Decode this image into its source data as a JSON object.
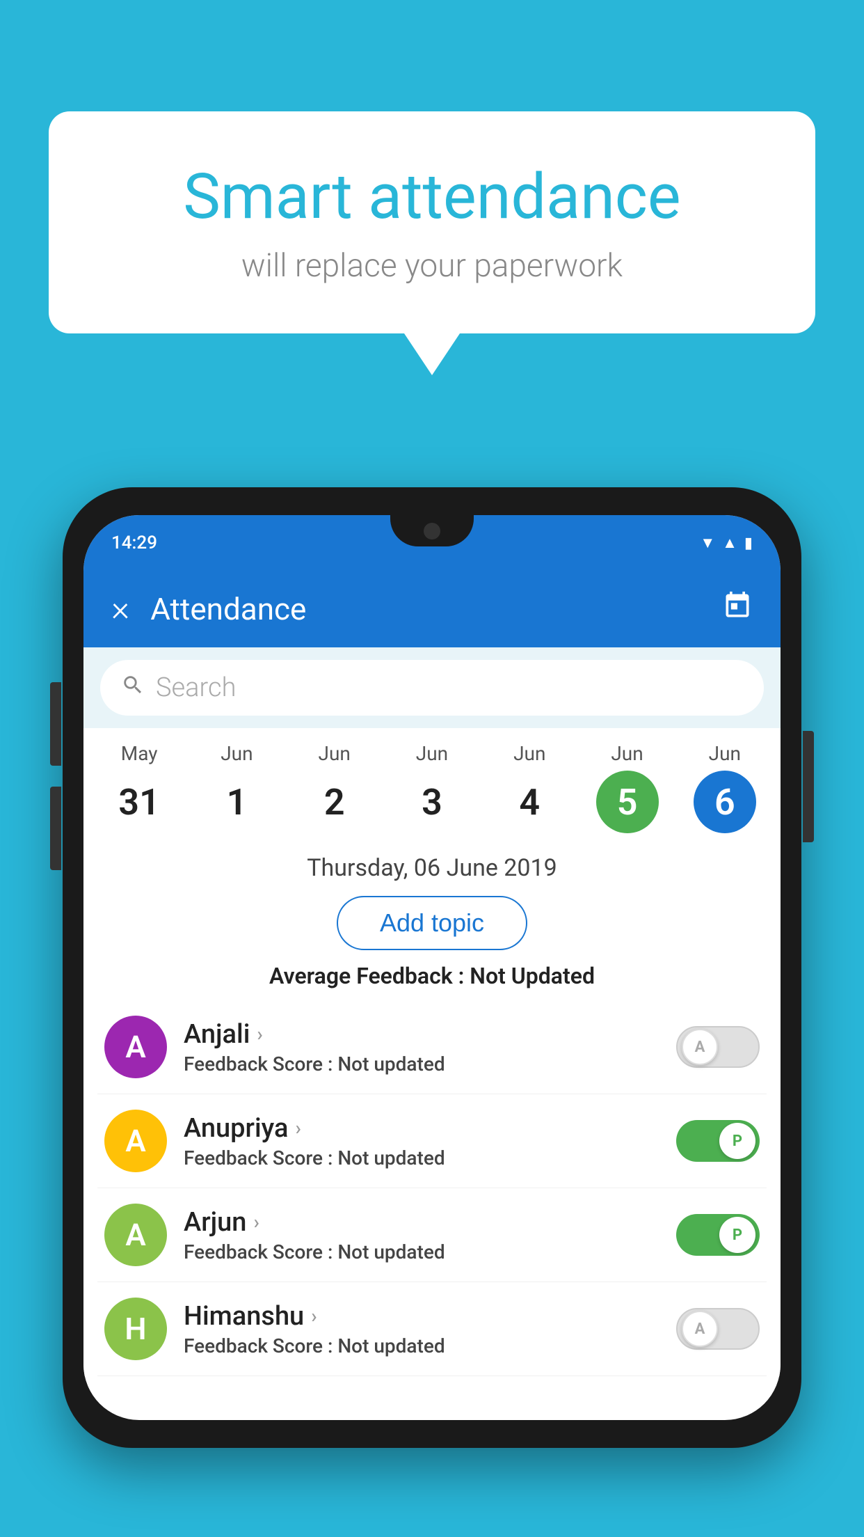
{
  "background_color": "#29b6d8",
  "speech_bubble": {
    "title": "Smart attendance",
    "subtitle": "will replace your paperwork"
  },
  "phone": {
    "status_bar": {
      "time": "14:29",
      "icons": [
        "wifi",
        "signal",
        "battery"
      ]
    },
    "app_header": {
      "title": "Attendance",
      "close_label": "×",
      "calendar_icon": "📅"
    },
    "search": {
      "placeholder": "Search"
    },
    "calendar": {
      "days": [
        {
          "month": "May",
          "date": "31",
          "state": "normal"
        },
        {
          "month": "Jun",
          "date": "1",
          "state": "normal"
        },
        {
          "month": "Jun",
          "date": "2",
          "state": "normal"
        },
        {
          "month": "Jun",
          "date": "3",
          "state": "normal"
        },
        {
          "month": "Jun",
          "date": "4",
          "state": "normal"
        },
        {
          "month": "Jun",
          "date": "5",
          "state": "today"
        },
        {
          "month": "Jun",
          "date": "6",
          "state": "selected"
        }
      ]
    },
    "selected_date": "Thursday, 06 June 2019",
    "add_topic_label": "Add topic",
    "average_feedback_label": "Average Feedback :",
    "average_feedback_value": "Not Updated",
    "students": [
      {
        "name": "Anjali",
        "avatar_letter": "A",
        "avatar_color": "#9c27b0",
        "feedback_label": "Feedback Score :",
        "feedback_value": "Not updated",
        "attendance": "absent",
        "toggle_label": "A"
      },
      {
        "name": "Anupriya",
        "avatar_letter": "A",
        "avatar_color": "#ffc107",
        "feedback_label": "Feedback Score :",
        "feedback_value": "Not updated",
        "attendance": "present",
        "toggle_label": "P"
      },
      {
        "name": "Arjun",
        "avatar_letter": "A",
        "avatar_color": "#8bc34a",
        "feedback_label": "Feedback Score :",
        "feedback_value": "Not updated",
        "attendance": "present",
        "toggle_label": "P"
      },
      {
        "name": "Himanshu",
        "avatar_letter": "H",
        "avatar_color": "#8bc34a",
        "feedback_label": "Feedback Score :",
        "feedback_value": "Not updated",
        "attendance": "absent",
        "toggle_label": "A"
      }
    ]
  }
}
